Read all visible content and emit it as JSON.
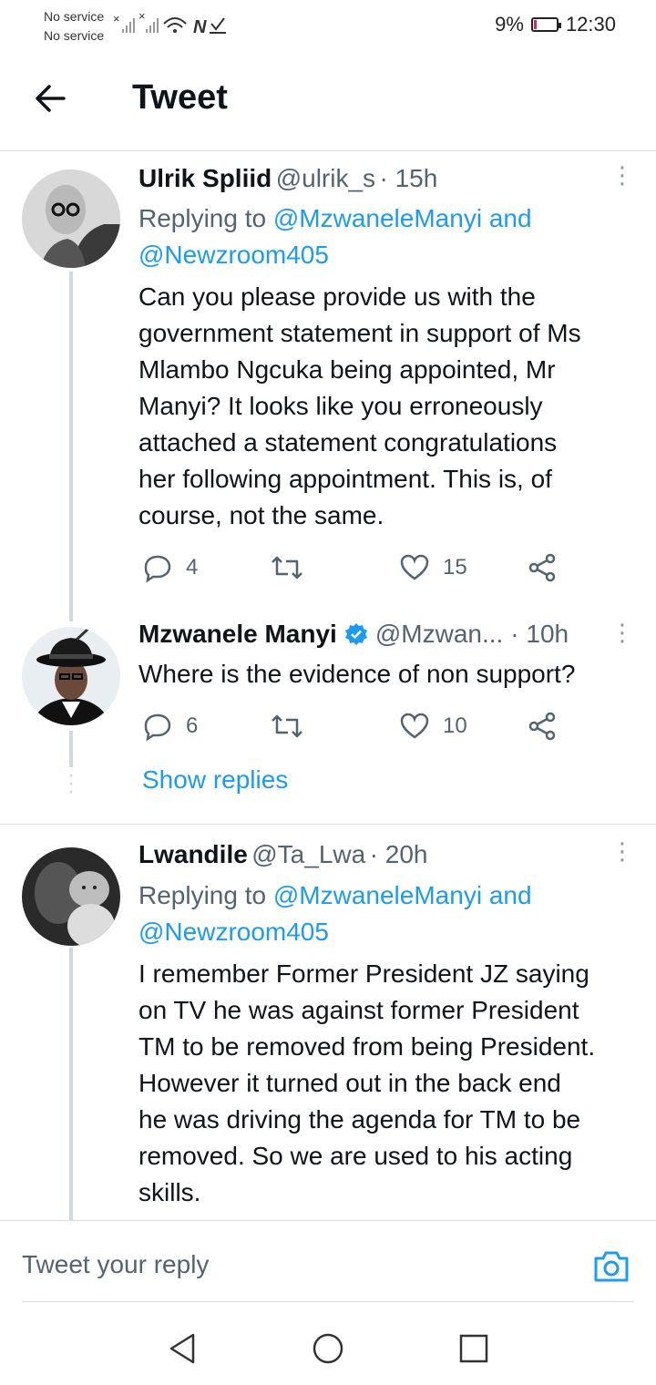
{
  "status": {
    "carrier1": "No service",
    "carrier2": "No service",
    "battery": "9%",
    "time": "12:30"
  },
  "header": {
    "title": "Tweet"
  },
  "tweets": [
    {
      "name": "Ulrik Spliid",
      "handle": "@ulrik_s",
      "time": "· 15h",
      "replying_prefix": "Replying to ",
      "replying_user1": "@MzwaneleManyi",
      "replying_and": " and",
      "replying_user2": "@Newzroom405",
      "body_lines": [
        "Can you please provide us with the",
        "government statement in support of Ms",
        "Mlambo Ngcuka being appointed, Mr",
        "Manyi? It looks like you erroneously",
        "attached a statement congratulations",
        "her following appointment. This is, of",
        "course, not the same."
      ],
      "replies": "4",
      "likes": "15"
    },
    {
      "name": "Mzwanele Manyi",
      "handle": "@Mzwan...",
      "time": "· 10h",
      "verified": true,
      "body": "Where is the evidence of non support?",
      "replies": "6",
      "likes": "10",
      "show_replies": "Show replies"
    },
    {
      "name": "Lwandile",
      "handle": "@Ta_Lwa",
      "time": "· 20h",
      "replying_prefix": "Replying to ",
      "replying_user1": "@MzwaneleManyi",
      "replying_and": " and",
      "replying_user2": "@Newzroom405",
      "body_lines": [
        "I remember Former President JZ saying",
        "on TV he was against former President",
        "TM to be removed from being President.",
        "However it turned out in the back end",
        "he was driving the agenda for TM to be",
        "removed. So we are used to his acting",
        "skills."
      ]
    }
  ],
  "compose": {
    "placeholder": "Tweet your reply"
  },
  "icons": {
    "reply": "reply-icon",
    "retweet": "retweet-icon",
    "like": "heart-icon",
    "share": "share-icon",
    "camera": "camera-icon",
    "verified": "verified-badge-icon"
  },
  "colors": {
    "link": "#1d9bf0",
    "muted": "#536471",
    "battery_low": "#e0245e"
  }
}
